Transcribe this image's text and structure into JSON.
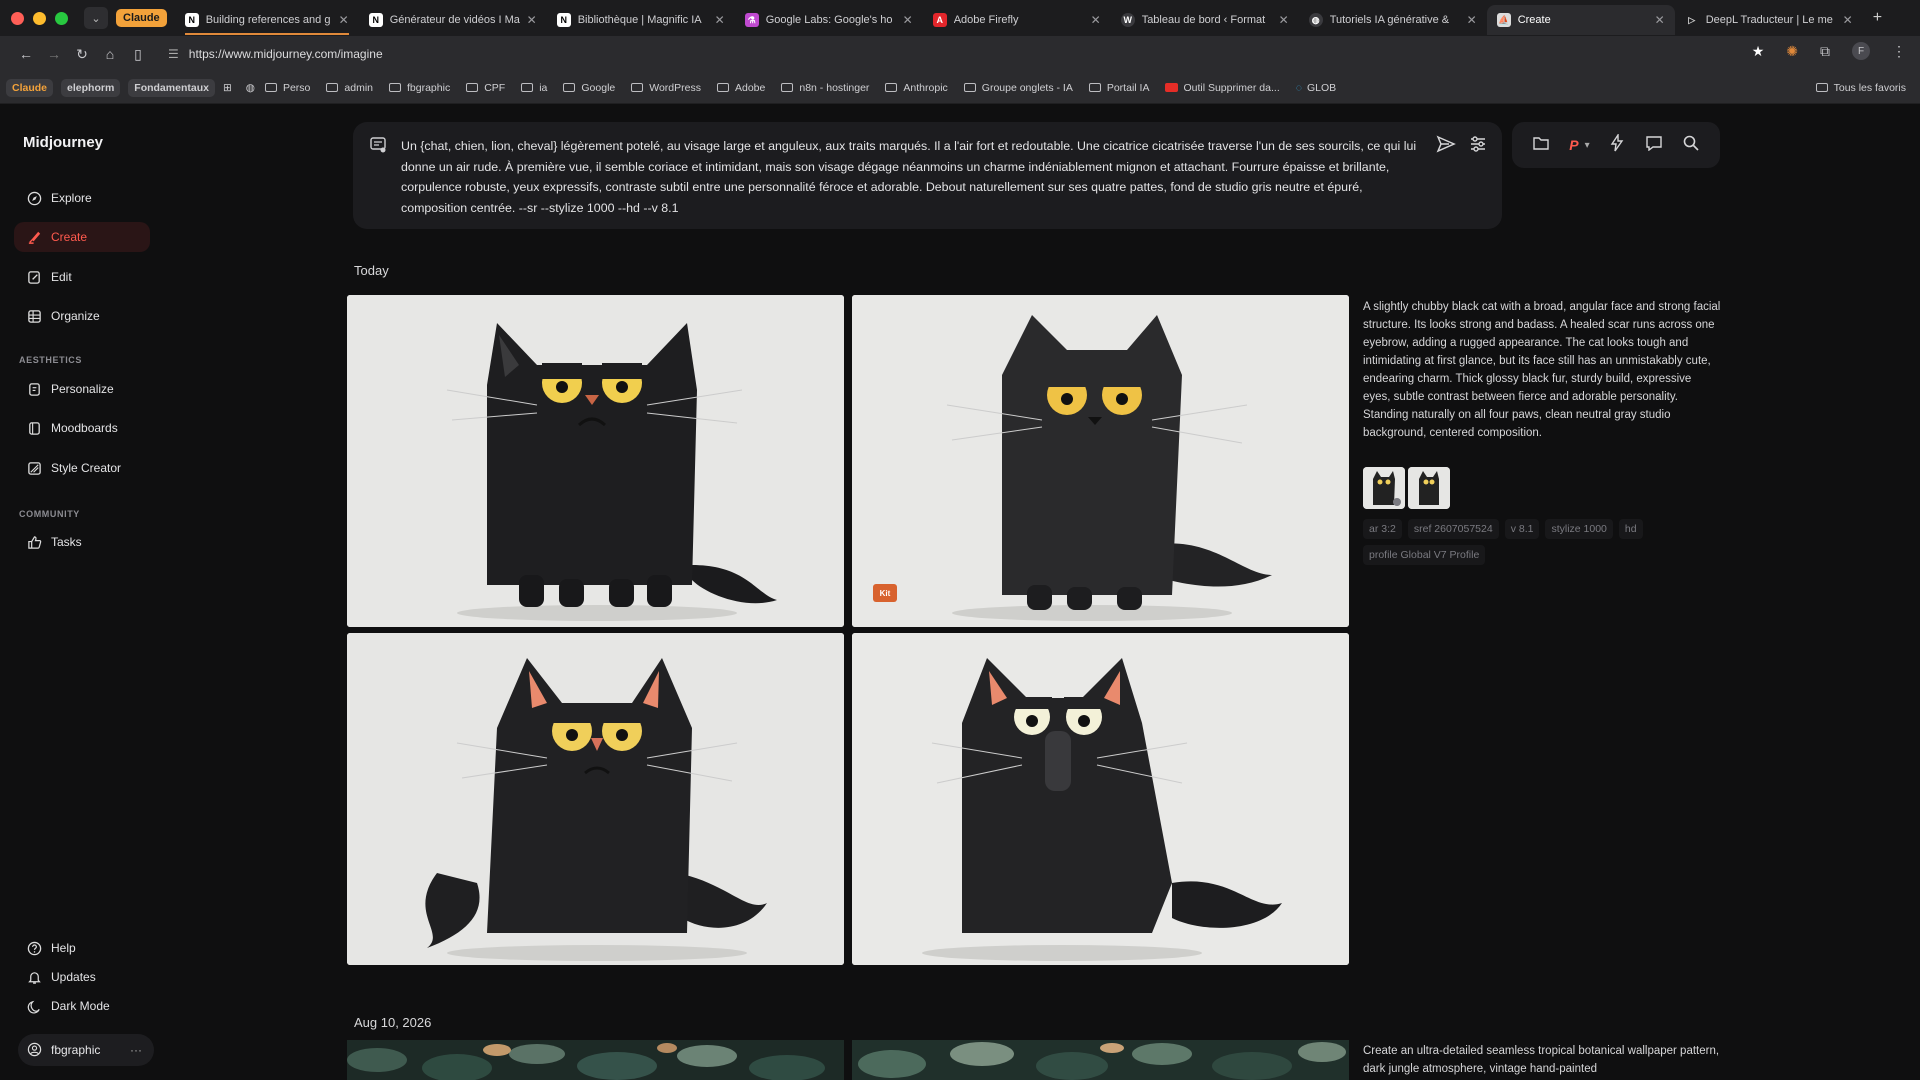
{
  "browser": {
    "tab_group_label": "Claude",
    "tabs": [
      {
        "title": "Building references and g",
        "icon": "notion-icon"
      },
      {
        "title": "Générateur de vidéos I Ma",
        "icon": "notion-icon"
      },
      {
        "title": "Bibliothèque | Magnific IA",
        "icon": "notion-icon"
      },
      {
        "title": "Google Labs: Google's ho",
        "icon": "labs-icon"
      },
      {
        "title": "Adobe Firefly",
        "icon": "adobe-icon"
      },
      {
        "title": "Tableau de bord ‹ Format",
        "icon": "wordpress-icon"
      },
      {
        "title": "Tutoriels IA générative &",
        "icon": "globe-icon"
      },
      {
        "title": "Create",
        "icon": "midjourney-icon"
      },
      {
        "title": "DeepL Traducteur | Le me",
        "icon": "deepl-icon"
      }
    ],
    "url": "https://www.midjourney.com/imagine",
    "bookmarks": [
      "Perso",
      "admin",
      "fbgraphic",
      "CPF",
      "ia",
      "Google",
      "WordPress",
      "Adobe",
      "n8n - hostinger",
      "Anthropic",
      "Groupe onglets - IA",
      "Portail IA",
      "Outil Supprimer da...",
      "GLOB"
    ],
    "bookmark_pills": [
      "Claude",
      "elephorm",
      "Fondamentaux"
    ],
    "all_favorites": "Tous les favoris",
    "profile_initial": "F"
  },
  "app": {
    "logo": "Midjourney",
    "nav": [
      {
        "label": "Explore",
        "icon": "compass-icon"
      },
      {
        "label": "Create",
        "icon": "brush-icon"
      },
      {
        "label": "Edit",
        "icon": "edit-icon"
      },
      {
        "label": "Organize",
        "icon": "grid-icon"
      }
    ],
    "aesthetics_label": "AESTHETICS",
    "aesthetics": [
      {
        "label": "Personalize",
        "icon": "personalize-icon"
      },
      {
        "label": "Moodboards",
        "icon": "moodboard-icon"
      },
      {
        "label": "Style Creator",
        "icon": "style-creator-icon"
      }
    ],
    "community_label": "COMMUNITY",
    "community": [
      {
        "label": "Tasks",
        "icon": "thumbs-up-icon"
      }
    ],
    "bottom": [
      {
        "label": "Help",
        "icon": "help-icon"
      },
      {
        "label": "Updates",
        "icon": "bell-icon"
      },
      {
        "label": "Dark Mode",
        "icon": "moon-icon"
      }
    ],
    "user": "fbgraphic"
  },
  "prompt": {
    "text": "Un {chat, chien, lion, cheval} légèrement potelé, au visage large et anguleux, aux traits marqués. Il a l'air fort et redoutable. Une cicatrice cicatrisée traverse l'un de ses sourcils, ce qui lui donne un air rude. À première vue, il semble coriace et intimidant, mais son visage dégage néanmoins un charme indéniablement mignon et attachant. Fourrure épaisse et brillante, corpulence robuste, yeux expressifs, contraste subtil entre une personnalité féroce et adorable. Debout naturellement sur ses quatre pattes, fond de studio gris neutre et épuré, composition centrée. --sr --stylize 1000 --hd --v 8.1",
    "profile_letter": "P"
  },
  "feed": {
    "today_label": "Today",
    "caption": "A slightly chubby black cat with a broad, angular face and strong facial structure. Its looks strong and badass. A healed scar runs across one eyebrow, adding a rugged appearance. The cat looks tough and intimidating at first glance, but its face still has an unmistakably cute, endearing charm. Thick glossy black fur, sturdy build, expressive eyes, subtle contrast between fierce and adorable personality. Standing naturally on all four paws, clean neutral gray studio background, centered composition.",
    "tags": [
      "ar 3:2",
      "sref 2607057524",
      "v 8.1",
      "stylize 1000",
      "hd",
      "profile Global V7 Profile"
    ],
    "badge": "Kit",
    "date2_label": "Aug 10, 2026",
    "caption2": "Create an ultra-detailed seamless tropical botanical wallpaper pattern, dark jungle atmosphere, vintage hand-painted"
  },
  "colors": {
    "accent": "#ff5a4e",
    "background": "#0f0f10",
    "panel": "#1c1c1f"
  }
}
